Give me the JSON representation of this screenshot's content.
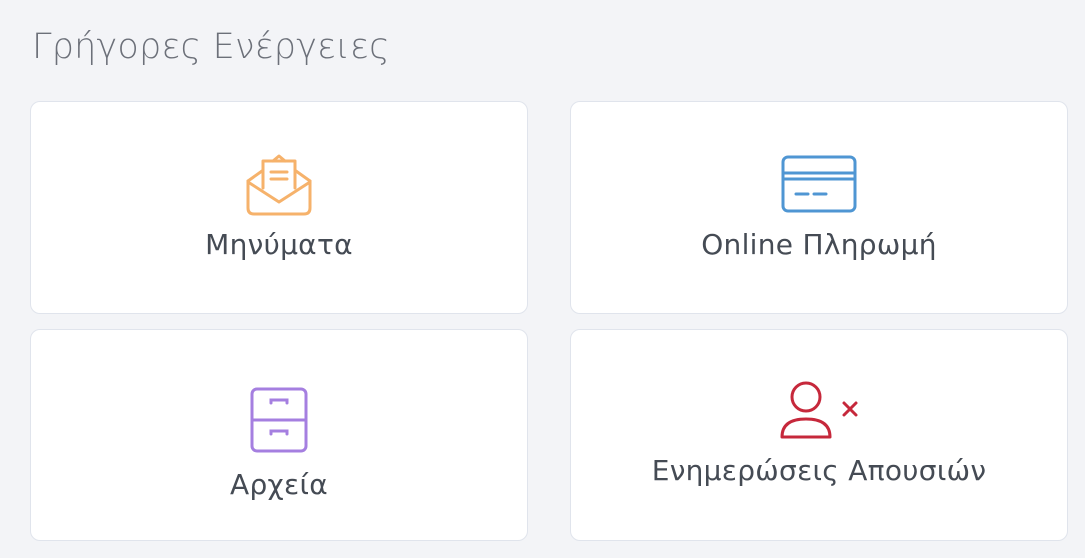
{
  "section": {
    "title": "Γρήγορες Ενέργειες"
  },
  "cards": [
    {
      "label": "Μηνύματα",
      "icon": "open-envelope-icon",
      "color": "#f6b26b"
    },
    {
      "label": "Online Πληρωμή",
      "icon": "credit-card-icon",
      "color": "#4f96d3"
    },
    {
      "label": "Αρχεία",
      "icon": "file-cabinet-icon",
      "color": "#a57fe0"
    },
    {
      "label": "Ενημερώσεις Απουσιών",
      "icon": "user-remove-icon",
      "color": "#c6283b"
    }
  ]
}
